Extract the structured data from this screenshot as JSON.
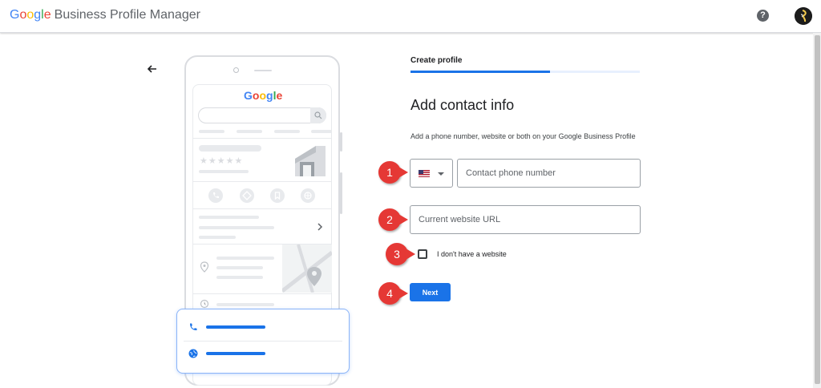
{
  "header": {
    "brand_google_letters": [
      "G",
      "o",
      "o",
      "g",
      "l",
      "e"
    ],
    "brand_product": "Business Profile Manager",
    "help_glyph": "?",
    "icons": {
      "help": "help-circle-icon",
      "avatar": "account-avatar"
    }
  },
  "illustration": {
    "google_letters": [
      "G",
      "o",
      "o",
      "g",
      "l",
      "e"
    ],
    "stars": "★★★★★",
    "icons": [
      "phone-icon",
      "directions-icon",
      "bookmark-icon",
      "globe-icon",
      "map-pin-icon",
      "clock-icon",
      "chevron-right-icon"
    ]
  },
  "form": {
    "step_label": "Create profile",
    "progress_fraction": 0.61,
    "title": "Add contact info",
    "subtitle": "Add a phone number, website or both on your Google Business Profile",
    "phone_placeholder": "Contact phone number",
    "website_placeholder": "Current website URL",
    "no_website_label": "I don't have a website",
    "next_label": "Next"
  },
  "callouts": [
    "1",
    "2",
    "3",
    "4"
  ],
  "colors": {
    "google_blue": "#4285F4",
    "google_red": "#EA4335",
    "google_yellow": "#FBBC05",
    "google_green": "#34A853",
    "primary": "#1a73e8",
    "callout_red": "#e53935"
  }
}
